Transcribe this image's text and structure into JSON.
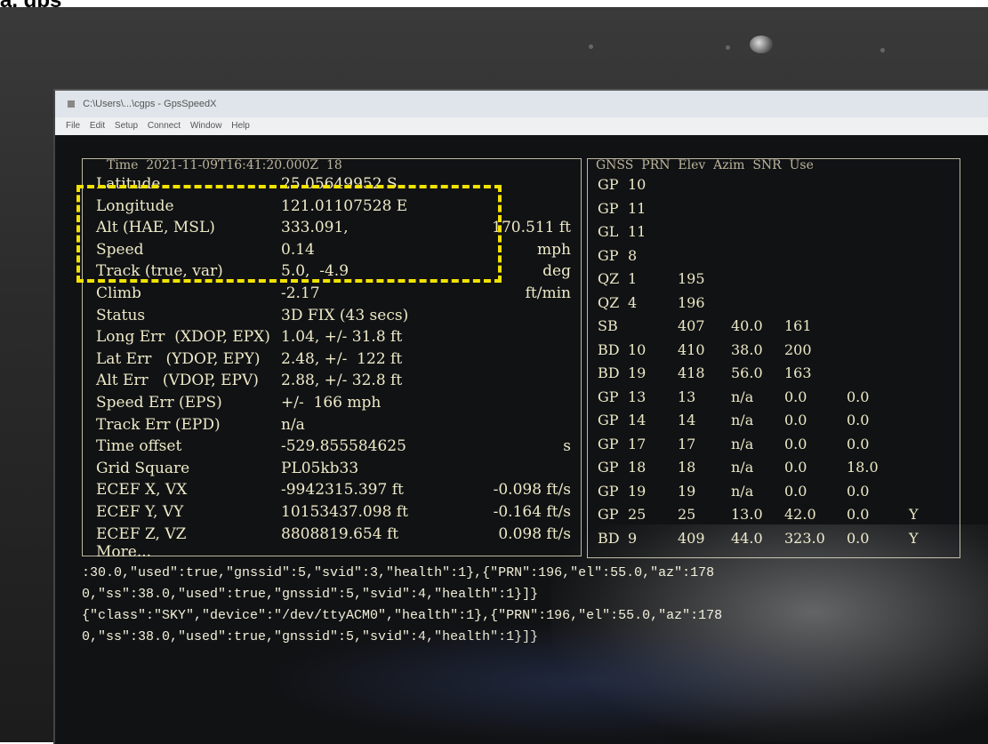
{
  "caption": "a. gps",
  "window": {
    "title": "C:\\Users\\...\\cgps - GpsSpeedX",
    "menu": [
      "File",
      "Edit",
      "Setup",
      "Connect",
      "Window",
      "Help"
    ]
  },
  "header_line": "Time  2021-11-09T16:41:20.000Z  18",
  "fields": [
    {
      "label": "Latitude",
      "value": "25.05649952 S",
      "unit": ""
    },
    {
      "label": "Longitude",
      "value": "121.01107528 E",
      "unit": ""
    },
    {
      "label": "Alt (HAE, MSL)",
      "value": "333.091,",
      "unit": "170.511 ft"
    },
    {
      "label": "Speed",
      "value": "0.14",
      "unit": "mph"
    },
    {
      "label": "Track (true, var)",
      "value": "5.0,  -4.9",
      "unit": "deg"
    },
    {
      "label": "Climb",
      "value": "-2.17",
      "unit": "ft/min"
    },
    {
      "label": "Status",
      "value": "3D FIX (43 secs)",
      "unit": ""
    },
    {
      "label": "Long Err  (XDOP, EPX)",
      "value": "1.04, +/- 31.8 ft",
      "unit": ""
    },
    {
      "label": "Lat Err   (YDOP, EPY)",
      "value": "2.48, +/-  122 ft",
      "unit": ""
    },
    {
      "label": "Alt Err   (VDOP, EPV)",
      "value": "2.88, +/- 32.8 ft",
      "unit": ""
    },
    {
      "label": "Speed Err (EPS)",
      "value": "+/-  166 mph",
      "unit": ""
    },
    {
      "label": "Track Err (EPD)",
      "value": "n/a",
      "unit": ""
    },
    {
      "label": "Time offset",
      "value": "-529.855584625",
      "unit": "s"
    },
    {
      "label": "Grid Square",
      "value": "PL05kb33",
      "unit": ""
    },
    {
      "label": "ECEF X, VX",
      "value": "-9942315.397 ft",
      "unit": "-0.098 ft/s"
    },
    {
      "label": "ECEF Y, VY",
      "value": "10153437.098 ft",
      "unit": "-0.164 ft/s"
    },
    {
      "label": "ECEF Z, VZ",
      "value": "8808819.654 ft",
      "unit": "0.098 ft/s"
    }
  ],
  "more_label": "More...",
  "sat_header": "GNSS  PRN  Elev  Azim  SNR  Use",
  "satellites": [
    {
      "gnss": "GP",
      "prn": "10",
      "a": "",
      "b": "",
      "c": "",
      "d": "",
      "e": ""
    },
    {
      "gnss": "GP",
      "prn": "11",
      "a": "",
      "b": "",
      "c": "",
      "d": "",
      "e": ""
    },
    {
      "gnss": "GL",
      "prn": "11",
      "a": "",
      "b": "",
      "c": "",
      "d": "",
      "e": ""
    },
    {
      "gnss": "GP",
      "prn": "8",
      "a": "",
      "b": "",
      "c": "",
      "d": "",
      "e": ""
    },
    {
      "gnss": "QZ",
      "prn": "1",
      "a": "195",
      "b": "",
      "c": "",
      "d": "",
      "e": ""
    },
    {
      "gnss": "QZ",
      "prn": "4",
      "a": "196",
      "b": "",
      "c": "",
      "d": "",
      "e": ""
    },
    {
      "gnss": "SB",
      "prn": "",
      "a": "407",
      "b": "40.0",
      "c": "161",
      "d": "",
      "e": ""
    },
    {
      "gnss": "BD",
      "prn": "10",
      "a": "410",
      "b": "38.0",
      "c": "200",
      "d": "",
      "e": ""
    },
    {
      "gnss": "BD",
      "prn": "19",
      "a": "418",
      "b": "56.0",
      "c": "163",
      "d": "",
      "e": ""
    },
    {
      "gnss": "GP",
      "prn": "13",
      "a": "13",
      "b": "n/a",
      "c": "0.0",
      "d": "0.0",
      "e": ""
    },
    {
      "gnss": "GP",
      "prn": "14",
      "a": "14",
      "b": "n/a",
      "c": "0.0",
      "d": "0.0",
      "e": ""
    },
    {
      "gnss": "GP",
      "prn": "17",
      "a": "17",
      "b": "n/a",
      "c": "0.0",
      "d": "0.0",
      "e": ""
    },
    {
      "gnss": "GP",
      "prn": "18",
      "a": "18",
      "b": "n/a",
      "c": "0.0",
      "d": "18.0",
      "e": ""
    },
    {
      "gnss": "GP",
      "prn": "19",
      "a": "19",
      "b": "n/a",
      "c": "0.0",
      "d": "0.0",
      "e": ""
    },
    {
      "gnss": "GP",
      "prn": "25",
      "a": "25",
      "b": "13.0",
      "c": "42.0",
      "d": "0.0",
      "e": "Y"
    },
    {
      "gnss": "BD",
      "prn": "9",
      "a": "409",
      "b": "44.0",
      "c": "323.0",
      "d": "0.0",
      "e": "Y"
    }
  ],
  "json_lines": [
    ":30.0,\"used\":true,\"gnssid\":5,\"svid\":3,\"health\":1},{\"PRN\":196,\"el\":55.0,\"az\":178",
    "0,\"ss\":38.0,\"used\":true,\"gnssid\":5,\"svid\":4,\"health\":1}]}",
    "{\"class\":\"SKY\",\"device\":\"/dev/ttyACM0\",\"health\":1},{\"PRN\":196,\"el\":55.0,\"az\":178",
    "0,\"ss\":38.0,\"used\":true,\"gnssid\":5,\"svid\":4,\"health\":1}]}"
  ]
}
